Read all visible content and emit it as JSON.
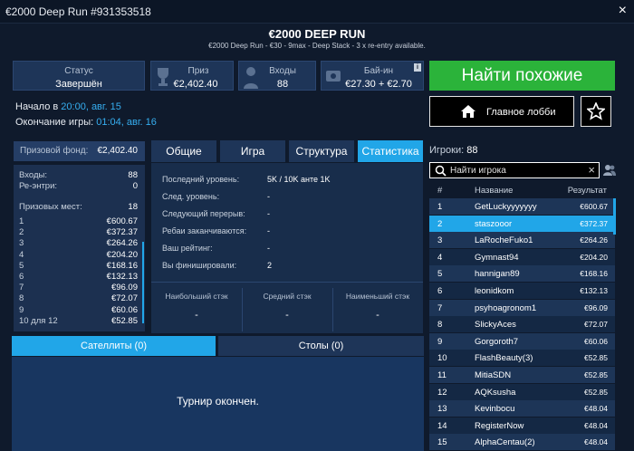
{
  "window": {
    "title": "€2000 Deep Run #931353518",
    "close": "×"
  },
  "header": {
    "title": "€2000 DEEP RUN",
    "subtitle": "€2000 Deep Run - €30 - 9max - Deep Stack - 3 x re-entry available."
  },
  "info_boxes": {
    "status": {
      "label": "Статус",
      "value": "Завершён"
    },
    "prize": {
      "label": "Приз",
      "value": "€2,402.40"
    },
    "entries": {
      "label": "Входы",
      "value": "88"
    },
    "buyin": {
      "label": "Бай-ин",
      "value": "€27.30 + €2.70",
      "info": "i"
    }
  },
  "times": {
    "start_label": "Начало в",
    "start_time": "20:00",
    "start_date": ", авг. 15",
    "end_label": "Окончание игры:",
    "end_time": "01:04",
    "end_date": ", авг. 16"
  },
  "actions": {
    "find_similar": "Найти похожие",
    "main_lobby": "Главное лобби"
  },
  "prize_fund": {
    "label": "Призовой фонд:",
    "value": "€2,402.40"
  },
  "entries_block": {
    "entries_label": "Входы:",
    "entries_value": "88",
    "reentries_label": "Ре-энтри:",
    "reentries_value": "0",
    "places_label": "Призовых мест:",
    "places_value": "18"
  },
  "payouts": [
    {
      "place": "1",
      "amount": "€600.67"
    },
    {
      "place": "2",
      "amount": "€372.37"
    },
    {
      "place": "3",
      "amount": "€264.26"
    },
    {
      "place": "4",
      "amount": "€204.20"
    },
    {
      "place": "5",
      "amount": "€168.16"
    },
    {
      "place": "6",
      "amount": "€132.13"
    },
    {
      "place": "7",
      "amount": "€96.09"
    },
    {
      "place": "8",
      "amount": "€72.07"
    },
    {
      "place": "9",
      "amount": "€60.06"
    },
    {
      "place": "10 для 12",
      "amount": "€52.85"
    }
  ],
  "tabs": [
    {
      "label": "Общие"
    },
    {
      "label": "Игра"
    },
    {
      "label": "Структура"
    },
    {
      "label": "Статистика"
    }
  ],
  "stats": {
    "rows": [
      {
        "label": "Последний уровень:",
        "value": "5K / 10K анте 1K"
      },
      {
        "label": "След. уровень:",
        "value": "-"
      },
      {
        "label": "Следующий перерыв:",
        "value": "-"
      },
      {
        "label": "Ребаи заканчиваются:",
        "value": "-"
      },
      {
        "label": "Ваш рейтинг:",
        "value": "-"
      },
      {
        "label": "Вы финишировали:",
        "value": "2"
      }
    ],
    "largest_stack": {
      "label": "Наибольший стэк",
      "value": "-"
    },
    "average_stack": {
      "label": "Средний стэк",
      "value": "-"
    },
    "smallest_stack": {
      "label": "Наименьший стэк",
      "value": "-"
    }
  },
  "bottom_tabs": {
    "satellites": "Сателлиты (0)",
    "tables": "Столы (0)"
  },
  "bottom_message": "Турнир окончен.",
  "players": {
    "label": "Игроки:",
    "count": "88",
    "search_placeholder": "Найти игрока",
    "headers": {
      "rank": "#",
      "name": "Название",
      "prize": "Результат"
    },
    "rows": [
      {
        "rank": "1",
        "name": "GetLuckyyyyyyy",
        "prize": "€600.67"
      },
      {
        "rank": "2",
        "name": "staszooor",
        "prize": "€372.37"
      },
      {
        "rank": "3",
        "name": "LaRocheFuko1",
        "prize": "€264.26"
      },
      {
        "rank": "4",
        "name": "Gymnast94",
        "prize": "€204.20"
      },
      {
        "rank": "5",
        "name": "hannigan89",
        "prize": "€168.16"
      },
      {
        "rank": "6",
        "name": "leonidkom",
        "prize": "€132.13"
      },
      {
        "rank": "7",
        "name": "psyhoagronom1",
        "prize": "€96.09"
      },
      {
        "rank": "8",
        "name": "SlickyAces",
        "prize": "€72.07"
      },
      {
        "rank": "9",
        "name": "Gorgoroth7",
        "prize": "€60.06"
      },
      {
        "rank": "10",
        "name": "FlashBeauty(3)",
        "prize": "€52.85"
      },
      {
        "rank": "11",
        "name": "MitiaSDN",
        "prize": "€52.85"
      },
      {
        "rank": "12",
        "name": "AQKsusha",
        "prize": "€52.85"
      },
      {
        "rank": "13",
        "name": "Kevinbocu",
        "prize": "€48.04"
      },
      {
        "rank": "14",
        "name": "RegisterNow",
        "prize": "€48.04"
      },
      {
        "rank": "15",
        "name": "AlphaCentau(2)",
        "prize": "€48.04"
      }
    ]
  },
  "colors": {
    "accent": "#21a6e8",
    "green": "#2bb33a",
    "bg": "#0f1a2c"
  }
}
